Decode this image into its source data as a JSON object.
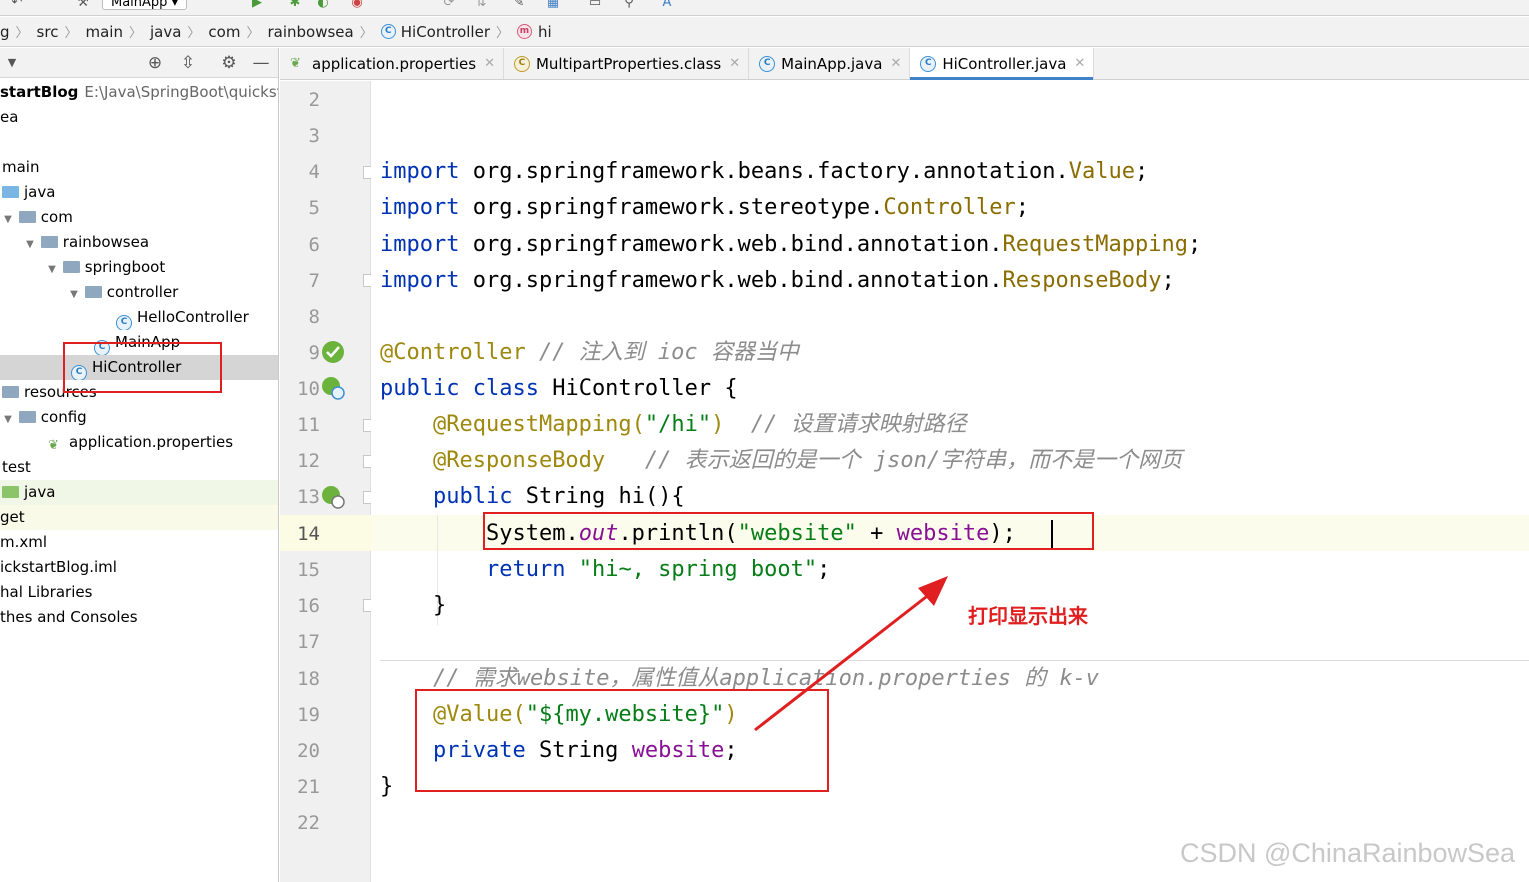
{
  "toolbar": {
    "run_config": "MainApp"
  },
  "breadcrumb": [
    "g",
    "src",
    "main",
    "java",
    "com",
    "rainbowsea",
    "HiController",
    "hi"
  ],
  "project": {
    "tree": [
      {
        "label": "startBlog",
        "path": "E:\\Java\\SpringBoot\\quicksta",
        "indent": 0,
        "type": "module"
      },
      {
        "label": "ea",
        "indent": 0,
        "type": "folder"
      },
      {
        "label": "",
        "indent": 0,
        "type": "empty"
      },
      {
        "label": "main",
        "indent": 0,
        "type": "folder"
      },
      {
        "label": "java",
        "indent": 1,
        "type": "src"
      },
      {
        "label": "com",
        "indent": 1,
        "type": "pkg"
      },
      {
        "label": "rainbowsea",
        "indent": 2,
        "type": "pkg"
      },
      {
        "label": "springboot",
        "indent": 3,
        "type": "pkg"
      },
      {
        "label": "controller",
        "indent": 4,
        "type": "pkg"
      },
      {
        "label": "HelloController",
        "indent": 5,
        "type": "class"
      },
      {
        "label": "MainApp",
        "indent": 4,
        "type": "class"
      },
      {
        "label": "HiController",
        "indent": 3,
        "type": "class"
      },
      {
        "label": "resources",
        "indent": 0,
        "type": "res"
      },
      {
        "label": "config",
        "indent": 1,
        "type": "folder"
      },
      {
        "label": "application.properties",
        "indent": 2,
        "type": "props"
      },
      {
        "label": "test",
        "indent": 0,
        "type": "folder"
      },
      {
        "label": "java",
        "indent": 0,
        "type": "testsrc"
      },
      {
        "label": "get",
        "indent": 0,
        "type": "folder"
      },
      {
        "label": "m.xml",
        "indent": 0,
        "type": "file"
      },
      {
        "label": "ickstartBlog.iml",
        "indent": 0,
        "type": "file"
      },
      {
        "label": "hal Libraries",
        "indent": 0,
        "type": "folder"
      },
      {
        "label": "thes and Consoles",
        "indent": 0,
        "type": "folder"
      }
    ]
  },
  "tabs": [
    {
      "label": "application.properties",
      "active": false
    },
    {
      "label": "MultipartProperties.class",
      "active": false
    },
    {
      "label": "MainApp.java",
      "active": false
    },
    {
      "label": "HiController.java",
      "active": true
    }
  ],
  "editor": {
    "line_numbers": [
      "2",
      "3",
      "4",
      "5",
      "6",
      "7",
      "8",
      "9",
      "10",
      "11",
      "12",
      "13",
      "14",
      "15",
      "16",
      "17",
      "18",
      "19",
      "20",
      "21",
      "22"
    ],
    "current_line": "14"
  },
  "code": {
    "import_kw": "import",
    "l4_pkg": "org.springframework.beans.factory.annotation.",
    "l4_cls": "Value",
    "l5_pkg": "org.springframework.stereotype.",
    "l5_cls": "Controller",
    "l6_pkg": "org.springframework.web.bind.annotation.",
    "l6_cls": "RequestMapping",
    "l7_pkg": "org.springframework.web.bind.annotation.",
    "l7_cls": "ResponseBody",
    "semi": ";",
    "l9_ann": "@Controller",
    "l9_cm": "// 注入到 ioc 容器当中",
    "l10_kw": "public class",
    "l10_rest": "HiController {",
    "l11_ann": "@RequestMapping(",
    "l11_str": "\"/hi\"",
    "l11_close": ")",
    "l11_cm": "// 设置请求映射路径",
    "l12_ann": "@ResponseBody",
    "l12_cm": "// 表示返回的是一个 json/字符串，而不是一个网页",
    "l13_kw": "public",
    "l13_rest": "String",
    "l13_m": "hi(){",
    "l14_a": "System.",
    "l14_out": "out",
    "l14_b": ".println(",
    "l14_str": "\"website\"",
    "l14_c": " + ",
    "l14_fld": "website",
    "l14_d": ");",
    "l15_kw": "return",
    "l15_str": "\"hi~, spring boot\"",
    "l15_semi": ";",
    "l16": "}",
    "l18_cm": "// 需求website，属性值从application.properties 的 k-v",
    "l19_ann": "@Value(",
    "l19_str": "\"${my.website}\"",
    "l19_close": ")",
    "l20_kw": "private",
    "l20_type": "String",
    "l20_fld": "website",
    "l20_semi": ";",
    "l21": "}"
  },
  "annotation": {
    "text": "打印显示出来"
  },
  "watermark": "CSDN @ChinaRainbowSea",
  "colors": {
    "keyword": "#0033b3",
    "annotation": "#9e880d",
    "string": "#067d17",
    "comment": "#8c8c8c",
    "field": "#871094",
    "highlight_red": "#e02020",
    "tab_active_underline": "#4083c9"
  }
}
